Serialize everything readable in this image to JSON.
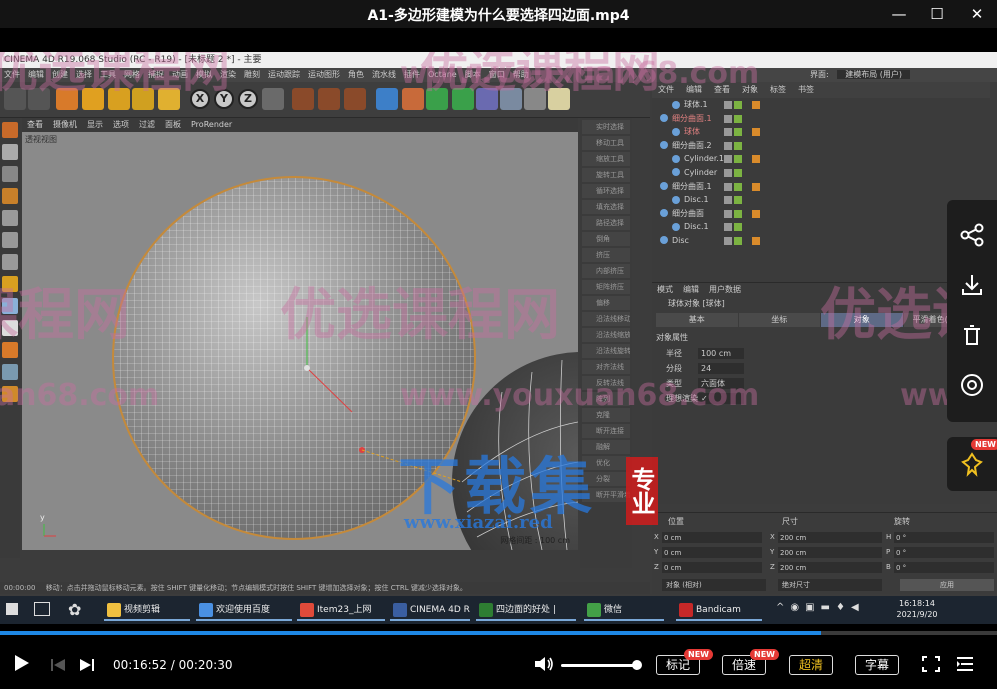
{
  "player": {
    "title": "A1-多边形建模为什么要选择四边面.mp4",
    "time_current": "00:16:52",
    "time_total": "00:20:30",
    "progress_fraction": 0.823,
    "volume_fraction": 1.0,
    "buttons": {
      "bookmark": "标记",
      "speed": "倍速",
      "quality": "超清",
      "subtitle": "字幕"
    },
    "badge_new": "NEW"
  },
  "c4d": {
    "title": "CINEMA 4D R19.068 Studio (RC - R19) - [未标题 2 *] - 主要",
    "menu": [
      "文件",
      "编辑",
      "创建",
      "选择",
      "工具",
      "网格",
      "捕捉",
      "动画",
      "模拟",
      "渲染",
      "雕刻",
      "运动跟踪",
      "运动图形",
      "角色",
      "流水线",
      "插件",
      "Octane",
      "脚本",
      "窗口",
      "帮助"
    ],
    "layout_label": "界面:",
    "layout_value": "建模布局 (用户)",
    "viewport_menu": [
      "查看",
      "摄像机",
      "显示",
      "选项",
      "过滤",
      "面板",
      "ProRender"
    ],
    "viewport_label": "透视视图",
    "grid_spacing": "网格间距 : 100 cm",
    "status": "移动：点击并拖动鼠标移动元素。按住 SHIFT 键量化移动；节点编辑模式时按住 SHIFT 键增加选择对象；按住 CTRL 键减少选择对象。",
    "timecode": "00:00:00",
    "mid_items": [
      "实时选择",
      "移动工具",
      "缩放工具",
      "旋转工具",
      "循环选择",
      "填充选择",
      "路径选择",
      "倒角",
      "挤压",
      "内部挤压",
      "矩阵挤压",
      "偏移",
      "沿法线移动",
      "沿法线缩放",
      "沿法线旋转",
      "对齐法线",
      "反转法线",
      "阵列",
      "克隆",
      "断开连接",
      "融解",
      "优化",
      "分裂",
      "断开平滑着色"
    ],
    "object_panel": {
      "menu": [
        "文件",
        "编辑",
        "查看",
        "对象",
        "标签",
        "书签"
      ],
      "rows": [
        {
          "indent": 1,
          "name": "球体.1",
          "color": "#cfcfcf"
        },
        {
          "indent": 0,
          "name": "细分曲面.1",
          "color": "#e08080"
        },
        {
          "indent": 1,
          "name": "球体",
          "color": "#e08080"
        },
        {
          "indent": 0,
          "name": "细分曲面.2",
          "color": "#cfcfcf"
        },
        {
          "indent": 1,
          "name": "Cylinder.1",
          "color": "#cfcfcf"
        },
        {
          "indent": 1,
          "name": "Cylinder",
          "color": "#cfcfcf"
        },
        {
          "indent": 0,
          "name": "细分曲面.1",
          "color": "#cfcfcf"
        },
        {
          "indent": 1,
          "name": "Disc.1",
          "color": "#cfcfcf"
        },
        {
          "indent": 0,
          "name": "细分曲面",
          "color": "#cfcfcf"
        },
        {
          "indent": 1,
          "name": "Disc.1",
          "color": "#cfcfcf"
        },
        {
          "indent": 0,
          "name": "Disc",
          "color": "#cfcfcf"
        }
      ]
    },
    "attributes": {
      "menu": [
        "模式",
        "编辑",
        "用户数据"
      ],
      "object": "球体对象 [球体]",
      "tabs": [
        "基本",
        "坐标",
        "对象",
        "平滑着色(Phong)"
      ],
      "active_tab": "对象",
      "section": "对象属性",
      "fields": [
        {
          "label": "半径",
          "value": "100 cm"
        },
        {
          "label": "分段",
          "value": "24"
        },
        {
          "label": "类型",
          "value": "六面体"
        },
        {
          "label": "理想渲染",
          "value": "✓"
        }
      ]
    },
    "coords": {
      "headers": [
        "位置",
        "尺寸",
        "旋转"
      ],
      "rows": [
        {
          "axis": "X",
          "pos": "0 cm",
          "size_axis": "X",
          "size": "200 cm",
          "rot_axis": "H",
          "rot": "0 °"
        },
        {
          "axis": "Y",
          "pos": "0 cm",
          "size_axis": "Y",
          "size": "200 cm",
          "rot_axis": "P",
          "rot": "0 °"
        },
        {
          "axis": "Z",
          "pos": "0 cm",
          "size_axis": "Z",
          "size": "200 cm",
          "rot_axis": "B",
          "rot": "0 °"
        }
      ],
      "mode_object": "对象 (相对)",
      "mode_size": "绝对尺寸",
      "apply": "应用"
    }
  },
  "taskbar": {
    "tasks": [
      {
        "label": "视频剪辑",
        "color": "#f0c040"
      },
      {
        "label": "欢迎使用百度",
        "color": "#4a90e2"
      },
      {
        "label": "Item23_上网",
        "color": "#e04a3a"
      },
      {
        "label": "CINEMA 4D R",
        "color": "#3a5ea0"
      },
      {
        "label": "四边面的好处 |",
        "color": "#2e7d32"
      },
      {
        "label": "微信",
        "color": "#43a047"
      },
      {
        "label": "Bandicam",
        "color": "#c62828"
      }
    ],
    "time": "16:18:14",
    "date": "2021/9/20"
  },
  "watermarks": {
    "brand_cn": "优选课程网",
    "brand_url": "www.youxuan68.com",
    "xiazai_cn": "下载集",
    "xiazai_pro": "专业",
    "xiazai_url": "www.xiazai.red"
  },
  "icons": {
    "minimize": "minimize-icon",
    "maximize": "maximize-icon",
    "close": "close-icon",
    "share": "share-icon",
    "download": "download-icon",
    "delete": "trash-icon",
    "target": "target-icon",
    "pin": "pin-icon"
  }
}
